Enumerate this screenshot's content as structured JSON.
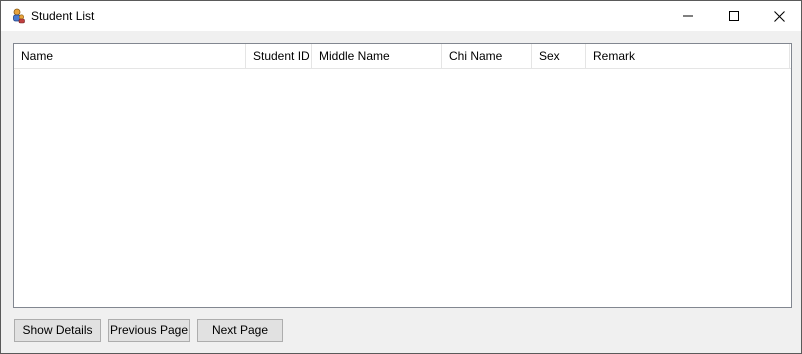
{
  "window": {
    "title": "Student List",
    "icon": "students-icon"
  },
  "listview": {
    "columns": [
      "Name",
      "Student ID",
      "Middle Name",
      "Chi Name",
      "Sex",
      "Remark"
    ],
    "rows": []
  },
  "buttons": {
    "show_details": "Show Details",
    "previous_page": "Previous Page",
    "next_page": "Next Page"
  }
}
